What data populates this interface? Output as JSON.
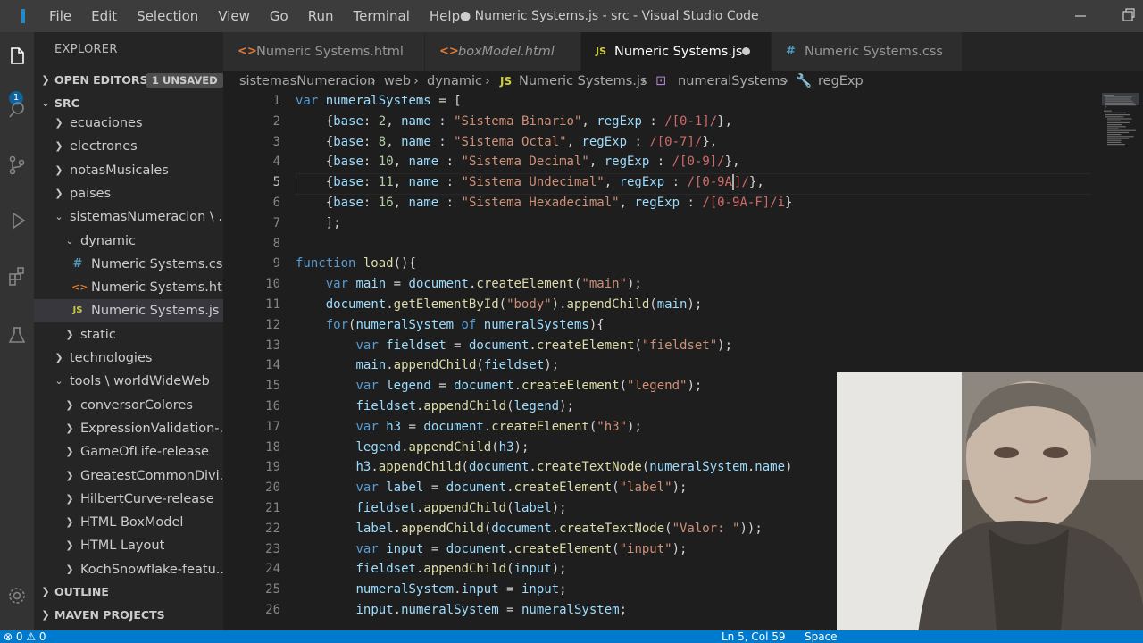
{
  "window": {
    "title": "● Numeric Systems.js - src - Visual Studio Code",
    "menu": [
      "File",
      "Edit",
      "Selection",
      "View",
      "Go",
      "Run",
      "Terminal",
      "Help"
    ],
    "minimize_icon": "minimize-icon",
    "restore_icon": "restore-icon"
  },
  "activity": {
    "badge": "1",
    "icons": [
      "files-icon",
      "search-icon",
      "source-control-icon",
      "run-debug-icon",
      "extensions-icon",
      "testing-icon",
      "settings-gear-icon"
    ]
  },
  "explorer": {
    "title": "EXPLORER",
    "open_editors": "OPEN EDITORS",
    "unsaved": "1 UNSAVED",
    "folder": "SRC",
    "outline": "OUTLINE",
    "maven": "MAVEN PROJECTS",
    "tree": [
      {
        "label": "ecuaciones",
        "type": "folder",
        "open": false
      },
      {
        "label": "electrones",
        "type": "folder",
        "open": false
      },
      {
        "label": "notasMusicales",
        "type": "folder",
        "open": false
      },
      {
        "label": "paises",
        "type": "folder",
        "open": false
      },
      {
        "label": "sistemasNumeracion \\ ...",
        "type": "folder",
        "open": true
      },
      {
        "label": "dynamic",
        "type": "folder",
        "open": true
      },
      {
        "label": "Numeric Systems.css",
        "type": "css"
      },
      {
        "label": "Numeric Systems.ht...",
        "type": "html"
      },
      {
        "label": "Numeric Systems.js",
        "type": "js",
        "selected": true
      },
      {
        "label": "static",
        "type": "folder",
        "open": false
      },
      {
        "label": "technologies",
        "type": "folder",
        "open": false
      },
      {
        "label": "tools \\ worldWideWeb",
        "type": "folder",
        "open": true
      },
      {
        "label": "conversorColores",
        "type": "folder",
        "open": false
      },
      {
        "label": "ExpressionValidation-...",
        "type": "folder",
        "open": false
      },
      {
        "label": "GameOfLife-release",
        "type": "folder",
        "open": false
      },
      {
        "label": "GreatestCommonDivi...",
        "type": "folder",
        "open": false
      },
      {
        "label": "HilbertCurve-release",
        "type": "folder",
        "open": false
      },
      {
        "label": "HTML BoxModel",
        "type": "folder",
        "open": false
      },
      {
        "label": "HTML Layout",
        "type": "folder",
        "open": false
      },
      {
        "label": "KochSnowflake-featu...",
        "type": "folder",
        "open": false
      }
    ]
  },
  "tabs": [
    {
      "label": "Numeric Systems.html",
      "icon": "<>",
      "color": "#e37933"
    },
    {
      "label": "boxModel.html",
      "icon": "<>",
      "color": "#e37933",
      "italic": true
    },
    {
      "label": "Numeric Systems.js",
      "icon": "JS",
      "color": "#cbcb41",
      "active": true,
      "dirty": true
    },
    {
      "label": "Numeric Systems.css",
      "icon": "#",
      "color": "#519aba"
    }
  ],
  "breadcrumb": [
    "sistemasNumeracion",
    "web",
    "dynamic",
    "Numeric Systems.js",
    "numeralSystems",
    "regExp"
  ],
  "code": [
    "var numeralSystems = [",
    "    {base: 2, name : \"Sistema Binario\", regExp : /[0-1]/},",
    "    {base: 8, name : \"Sistema Octal\", regExp : /[0-7]/},",
    "    {base: 10, name : \"Sistema Decimal\", regExp : /[0-9]/},",
    "    {base: 11, name : \"Sistema Undecimal\", regExp : /[0-9A]/},",
    "    {base: 16, name : \"Sistema Hexadecimal\", regExp : /[0-9A-F]/i}",
    "    ];",
    "",
    "function load(){",
    "    var main = document.createElement(\"main\");",
    "    document.getElementById(\"body\").appendChild(main);",
    "    for(numeralSystem of numeralSystems){",
    "        var fieldset = document.createElement(\"fieldset\");",
    "        main.appendChild(fieldset);",
    "        var legend = document.createElement(\"legend\");",
    "        fieldset.appendChild(legend);",
    "        var h3 = document.createElement(\"h3\");",
    "        legend.appendChild(h3);",
    "        h3.appendChild(document.createTextNode(numeralSystem.name)",
    "        var label = document.createElement(\"label\");",
    "        fieldset.appendChild(label);",
    "        label.appendChild(document.createTextNode(\"Valor: \"));",
    "        var input = document.createElement(\"input\");",
    "        fieldset.appendChild(input);",
    "        numeralSystem.input = input;",
    "        input.numeralSystem = numeralSystem;"
  ],
  "status": {
    "problems": "⊗ 0 ⚠ 0",
    "position": "Ln 5, Col 59",
    "spaces": "Space"
  },
  "colors": {
    "accent": "#007acc",
    "keyword": "#569cd6",
    "function": "#dcdcaa",
    "variable": "#9cdcfe",
    "string": "#ce9178",
    "regex": "#d16969",
    "number": "#b5cea8"
  }
}
